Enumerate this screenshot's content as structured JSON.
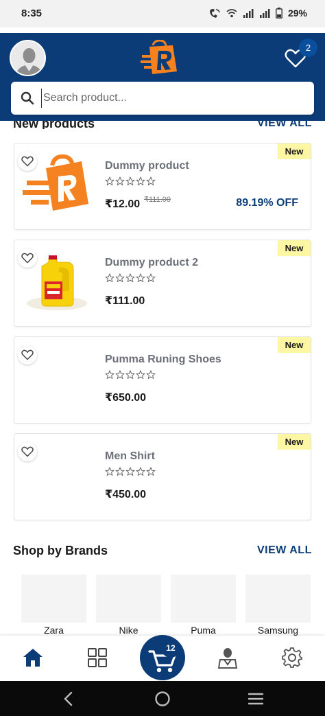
{
  "status_bar": {
    "time": "8:35",
    "battery": "29%"
  },
  "header": {
    "wishlist_count": "2",
    "search_placeholder": "Search product..."
  },
  "new_products": {
    "title": "New products",
    "view_all": "VIEW ALL",
    "items": [
      {
        "name": "Dummy product",
        "price": "₹12.00",
        "old_price": "₹111.00",
        "discount": "89.19% OFF",
        "tag": "New",
        "rating": 0,
        "image": "brand-logo"
      },
      {
        "name": "Dummy product 2",
        "price": "₹111.00",
        "tag": "New",
        "rating": 0,
        "image": "oil-can"
      },
      {
        "name": "Pumma Runing Shoes",
        "price": "₹650.00",
        "tag": "New",
        "rating": 0,
        "image": "none"
      },
      {
        "name": "Men Shirt",
        "price": "₹450.00",
        "tag": "New",
        "rating": 0,
        "image": "none"
      }
    ]
  },
  "brands": {
    "title": "Shop by Brands",
    "view_all": "VIEW ALL",
    "items": [
      "Zara",
      "Nike",
      "Puma",
      "Samsung"
    ]
  },
  "bottom_nav": {
    "cart_count": "12",
    "items": [
      "home-icon",
      "grid-icon",
      "cart-icon",
      "user-icon",
      "settings-icon"
    ]
  },
  "colors": {
    "primary": "#0c3c78",
    "accent_orange": "#f58220",
    "new_tag": "#fdf7a3"
  }
}
